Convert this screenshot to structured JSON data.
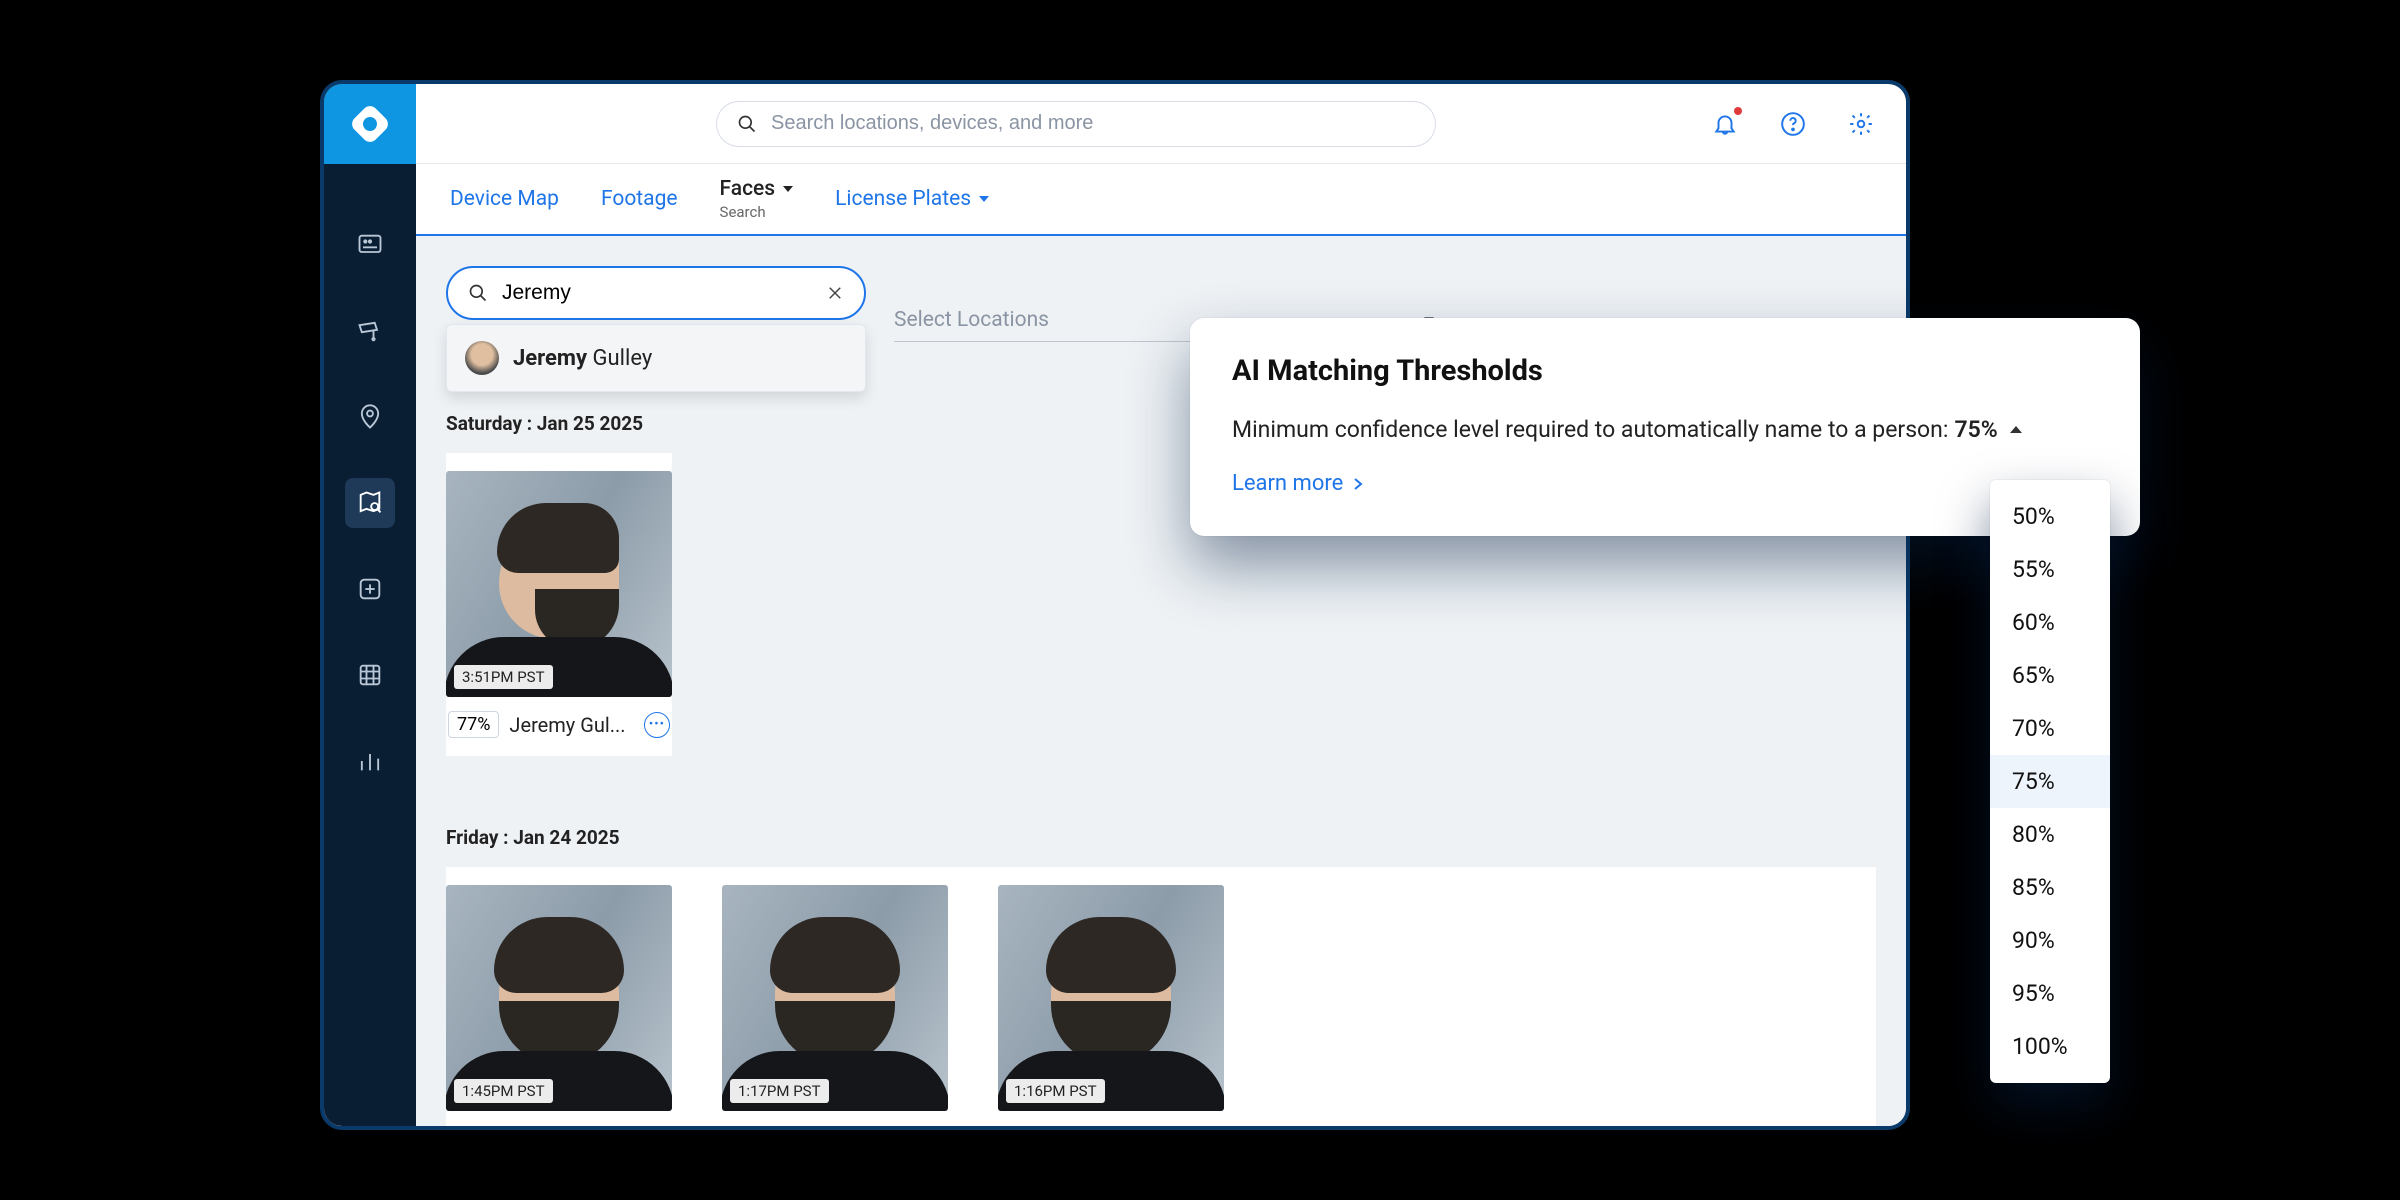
{
  "search": {
    "placeholder": "Search locations, devices, and more"
  },
  "tabs": {
    "device_map": "Device Map",
    "footage": "Footage",
    "faces": "Faces",
    "faces_sub": "Search",
    "plates": "License Plates"
  },
  "face_search": {
    "value": "Jeremy",
    "suggestion_first": "Jeremy",
    "suggestion_last": " Gulley"
  },
  "location_select": {
    "placeholder": "Select Locations"
  },
  "days": [
    {
      "label": "Saturday : Jan 25 2025",
      "cards": [
        {
          "time": "3:51PM PST",
          "pct": "77%",
          "name": "Jeremy Gul..."
        }
      ]
    },
    {
      "label": "Friday : Jan 24 2025",
      "cards": [
        {
          "time": "1:45PM PST"
        },
        {
          "time": "1:17PM PST"
        },
        {
          "time": "1:16PM PST"
        }
      ]
    }
  ],
  "popover": {
    "title": "AI Matching Thresholds",
    "description": "Minimum confidence level required to automatically name to a person:",
    "current": "75%",
    "learn_more": "Learn more"
  },
  "threshold_options": [
    "50%",
    "55%",
    "60%",
    "65%",
    "70%",
    "75%",
    "80%",
    "85%",
    "90%",
    "95%",
    "100%"
  ],
  "threshold_selected": "75%"
}
